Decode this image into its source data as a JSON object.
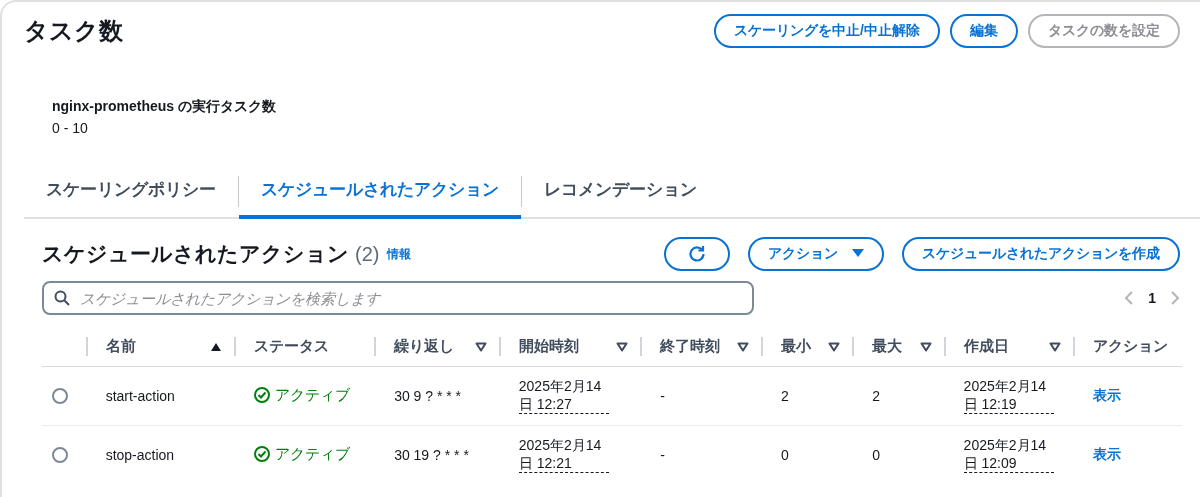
{
  "panel": {
    "title": "タスク数",
    "buttons": [
      {
        "label": "スケーリングを中止/中止解除",
        "disabled": false
      },
      {
        "label": "編集",
        "disabled": false
      },
      {
        "label": "タスクの数を設定",
        "disabled": true
      }
    ],
    "detail": {
      "label": "nginx-prometheus の実行タスク数",
      "value": "0 - 10"
    }
  },
  "tabs": [
    {
      "label": "スケーリングポリシー",
      "selected": false
    },
    {
      "label": "スケジュールされたアクション",
      "selected": true
    },
    {
      "label": "レコメンデーション",
      "selected": false
    }
  ],
  "section": {
    "title": "スケジュールされたアクション",
    "count": "(2)",
    "info_link": "情報",
    "actions_button": "アクション",
    "create_button": "スケジュールされたアクションを作成",
    "search": {
      "placeholder": "スケジュールされたアクションを検索します"
    },
    "pagination": {
      "page": "1"
    }
  },
  "table": {
    "columns": [
      {
        "label": "名前",
        "sorted": true
      },
      {
        "label": "ステータス",
        "sortable": false
      },
      {
        "label": "繰り返し",
        "sortable": true
      },
      {
        "label": "開始時刻",
        "sortable": true
      },
      {
        "label": "終了時刻",
        "sortable": true
      },
      {
        "label": "最小",
        "sortable": true
      },
      {
        "label": "最大",
        "sortable": true
      },
      {
        "label": "作成日",
        "sortable": true
      },
      {
        "label": "アクション",
        "sortable": false
      }
    ],
    "rows": [
      {
        "selected": false,
        "name": "start-action",
        "status": "アクティブ",
        "repeat": "30 9 ? * * *",
        "start": "2025年2月14日 12:27",
        "end": "-",
        "min": "2",
        "max": "2",
        "created": "2025年2月14日 12:19",
        "action": "表示"
      },
      {
        "selected": false,
        "name": "stop-action",
        "status": "アクティブ",
        "repeat": "30 19 ? * * *",
        "start": "2025年2月14日 12:21",
        "end": "-",
        "min": "0",
        "max": "0",
        "created": "2025年2月14日 12:09",
        "action": "表示"
      }
    ]
  }
}
